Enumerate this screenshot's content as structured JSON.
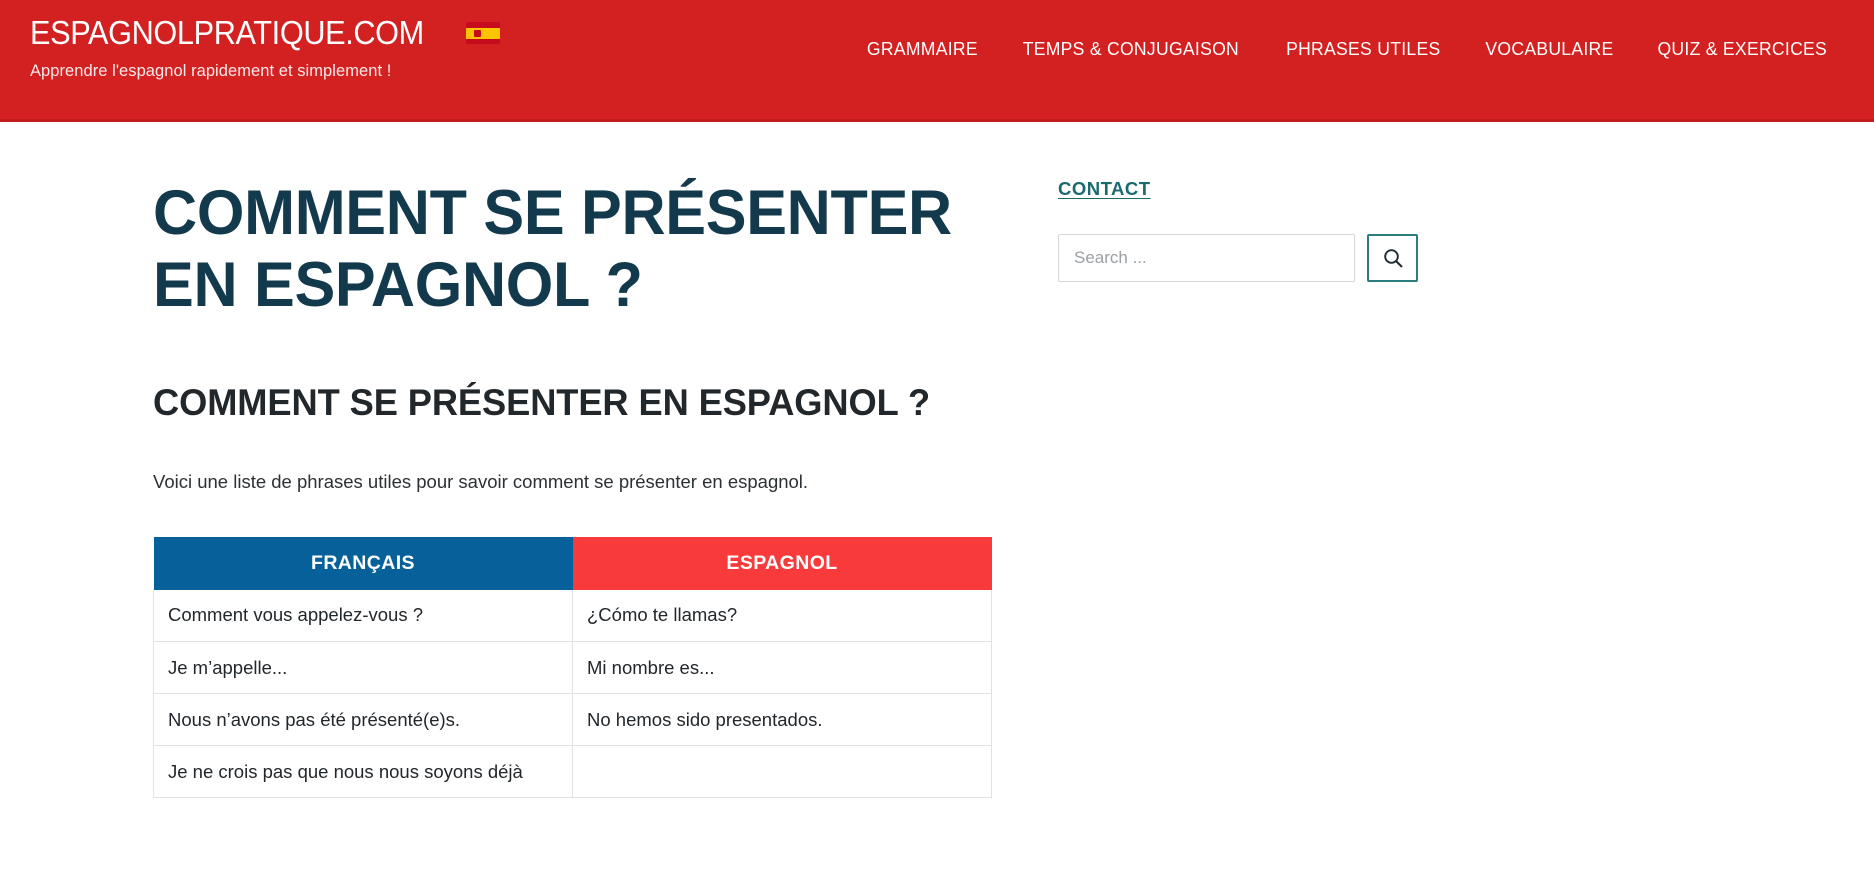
{
  "header": {
    "site_title": "ESPAGNOLPRATIQUE.COM",
    "flag_icon": "spain-flag-icon",
    "tagline": "Apprendre l'espagnol rapidement et simplement !",
    "brand_color": "#d32020",
    "nav": [
      {
        "label": "GRAMMAIRE"
      },
      {
        "label": "TEMPS & CONJUGAISON"
      },
      {
        "label": "PHRASES UTILES"
      },
      {
        "label": "VOCABULAIRE"
      },
      {
        "label": "QUIZ & EXERCICES"
      }
    ]
  },
  "main": {
    "entry_title": "COMMENT SE PRÉSENTER EN ESPAGNOL ?",
    "entry_title_color": "#13394c",
    "entry_subtitle": "COMMENT SE PRÉSENTER EN ESPAGNOL ?",
    "paragraph": "Voici une liste de phrases utiles pour savoir comment se présenter en espagnol.",
    "table": {
      "columns": [
        {
          "label": "FRANÇAIS",
          "color": "#06619a"
        },
        {
          "label": "ESPAGNOL",
          "color": "#f93a3a"
        }
      ],
      "rows": [
        {
          "fr": "Comment vous appelez-vous ?",
          "es": "¿Cómo te llamas?"
        },
        {
          "fr": "Je m’appelle...",
          "es": "Mi nombre es..."
        },
        {
          "fr": "Nous n’avons pas été  présenté(e)s.",
          "es": "No hemos sido presentados."
        },
        {
          "fr": "Je ne crois  pas que nous nous soyons  déjà",
          "es": ""
        }
      ]
    }
  },
  "sidebar": {
    "contact_label": "CONTACT",
    "contact_color": "#1a6a6e",
    "search": {
      "placeholder": "Search ...",
      "value": "",
      "button_icon": "search-icon",
      "button_color": "#2c7d80"
    }
  }
}
